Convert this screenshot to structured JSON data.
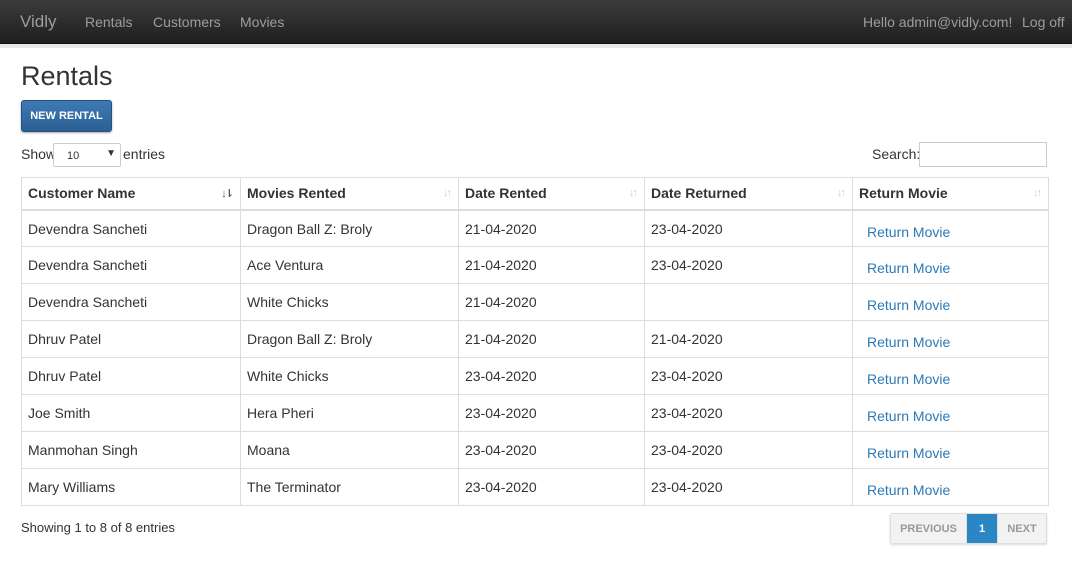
{
  "navbar": {
    "brand": "Vidly",
    "links": [
      "Rentals",
      "Customers",
      "Movies"
    ],
    "greeting": "Hello admin@vidly.com!",
    "logoff": "Log off"
  },
  "page": {
    "title": "Rentals",
    "new_button": "New Rental"
  },
  "table_controls": {
    "show_label": "Show",
    "length_value": "10",
    "entries_label": "entries",
    "search_label": "Search:",
    "search_value": ""
  },
  "table": {
    "columns": [
      "Customer Name",
      "Movies Rented",
      "Date Rented",
      "Date Returned",
      "Return Movie"
    ],
    "sorted_column": "Customer Name",
    "rows": [
      {
        "customer": "Devendra Sancheti",
        "movie": "Dragon Ball Z: Broly",
        "date_rented": "21-04-2020",
        "date_returned": "23-04-2020",
        "action": "Return Movie"
      },
      {
        "customer": "Devendra Sancheti",
        "movie": "Ace Ventura",
        "date_rented": "21-04-2020",
        "date_returned": "23-04-2020",
        "action": "Return Movie"
      },
      {
        "customer": "Devendra Sancheti",
        "movie": "White Chicks",
        "date_rented": "21-04-2020",
        "date_returned": "",
        "action": "Return Movie"
      },
      {
        "customer": "Dhruv Patel",
        "movie": "Dragon Ball Z: Broly",
        "date_rented": "21-04-2020",
        "date_returned": "21-04-2020",
        "action": "Return Movie"
      },
      {
        "customer": "Dhruv Patel",
        "movie": "White Chicks",
        "date_rented": "23-04-2020",
        "date_returned": "23-04-2020",
        "action": "Return Movie"
      },
      {
        "customer": "Joe Smith",
        "movie": "Hera Pheri",
        "date_rented": "23-04-2020",
        "date_returned": "23-04-2020",
        "action": "Return Movie"
      },
      {
        "customer": "Manmohan Singh",
        "movie": "Moana",
        "date_rented": "23-04-2020",
        "date_returned": "23-04-2020",
        "action": "Return Movie"
      },
      {
        "customer": "Mary Williams",
        "movie": "The Terminator",
        "date_rented": "23-04-2020",
        "date_returned": "23-04-2020",
        "action": "Return Movie"
      }
    ]
  },
  "footer": {
    "info": "Showing 1 to 8 of 8 entries",
    "pagination": {
      "previous": "Previous",
      "current": "1",
      "next": "Next"
    }
  },
  "colors": {
    "navbar": "#2b2b2b",
    "primary_button": "#2a5f94",
    "link": "#2a7ab8",
    "active_page": "#2a87c4"
  }
}
